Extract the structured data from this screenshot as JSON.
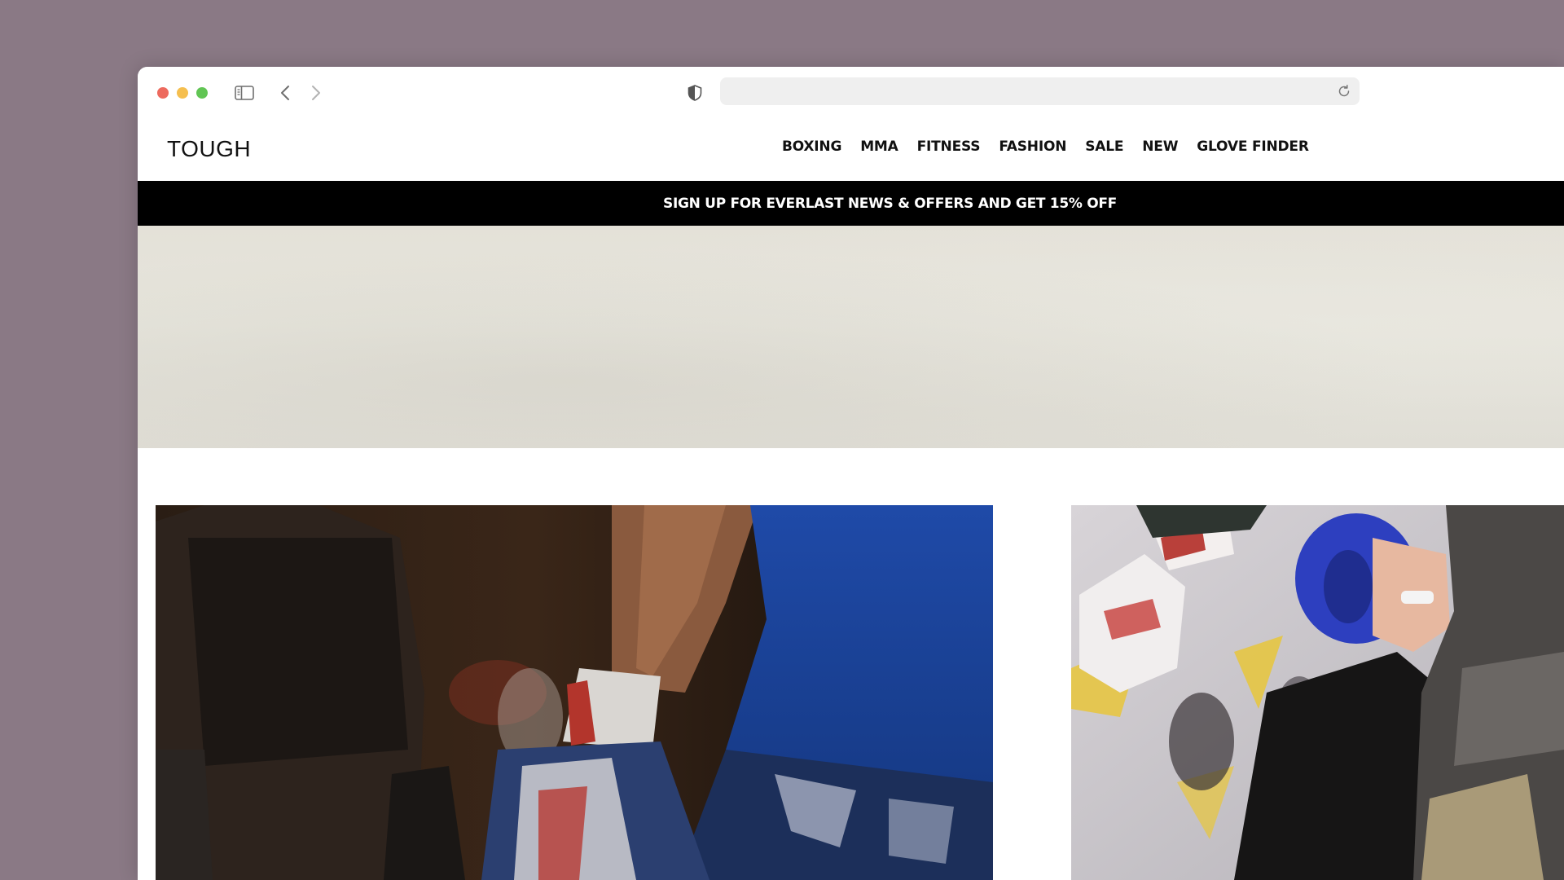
{
  "browser": {
    "url": "",
    "colors": {
      "close": "#ed6a5e",
      "minimize": "#f5bf4f",
      "maximize": "#61c554"
    },
    "icons": [
      "sidebar-toggle-icon",
      "chevron-left-icon",
      "chevron-right-icon",
      "shield-icon",
      "reload-icon"
    ]
  },
  "site": {
    "logo": "TOUGH",
    "nav": [
      "BOXING",
      "MMA",
      "FITNESS",
      "FASHION",
      "SALE",
      "NEW",
      "GLOVE FINDER"
    ],
    "promo": "SIGN UP FOR EVERLAST NEWS & OFFERS AND GET 15% OFF",
    "colors": {
      "promo_bg": "#000000",
      "promo_text": "#ffffff",
      "hero_bg": "#e4e1d8"
    }
  }
}
